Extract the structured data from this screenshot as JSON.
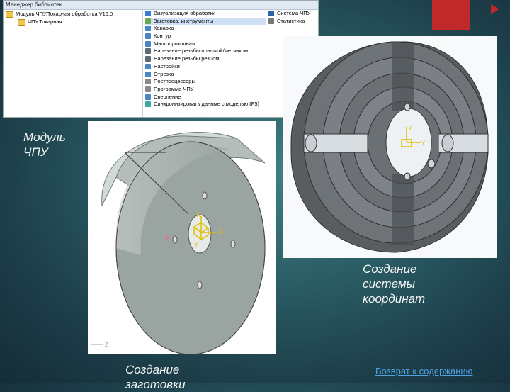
{
  "library_window": {
    "title": "Менеджер библиотек",
    "tree": [
      {
        "label": "Модуль ЧПУ.Токарная обработка V16.0"
      },
      {
        "label": "ЧПУ.Токарная"
      }
    ],
    "commands": [
      {
        "label": "Визуализация обработки",
        "icon": "visualize-icon"
      },
      {
        "label": "Заготовка, инструменты",
        "icon": "blank-icon",
        "selected": true
      },
      {
        "label": "Канавка",
        "icon": "groove-icon"
      },
      {
        "label": "Контур",
        "icon": "contour-icon"
      },
      {
        "label": "Многопроходная",
        "icon": "multipass-icon"
      },
      {
        "label": "Нарезание резьбы плашкой/метчиком",
        "icon": "thread-die-icon"
      },
      {
        "label": "Нарезание резьбы резцом",
        "icon": "thread-cutter-icon"
      },
      {
        "label": "Настройки",
        "icon": "settings-icon"
      },
      {
        "label": "Отрезка",
        "icon": "cutoff-icon"
      },
      {
        "label": "Постпроцессоры",
        "icon": "postprocessor-icon"
      },
      {
        "label": "Программа ЧПУ",
        "icon": "program-icon"
      },
      {
        "label": "Сверление",
        "icon": "drill-icon"
      },
      {
        "label": "Синхронизировать данные с моделью (F5)",
        "icon": "sync-icon"
      }
    ],
    "side_commands": [
      {
        "label": "Система ЧПУ",
        "icon": "nc-icon"
      },
      {
        "label": "Статистика",
        "icon": "stats-icon"
      }
    ]
  },
  "captions": {
    "module": "Модуль ЧПУ",
    "coordinate_system": "Создание системы координат",
    "blank": "Создание заготовки"
  },
  "back_link": "Возврат к содержанию",
  "axis_labels": {
    "x": "X",
    "y": "Y",
    "z": "Z"
  },
  "colors": {
    "accent_red": "#c0282a",
    "link": "#4fa3e3",
    "caption": "#f4f6f6"
  }
}
